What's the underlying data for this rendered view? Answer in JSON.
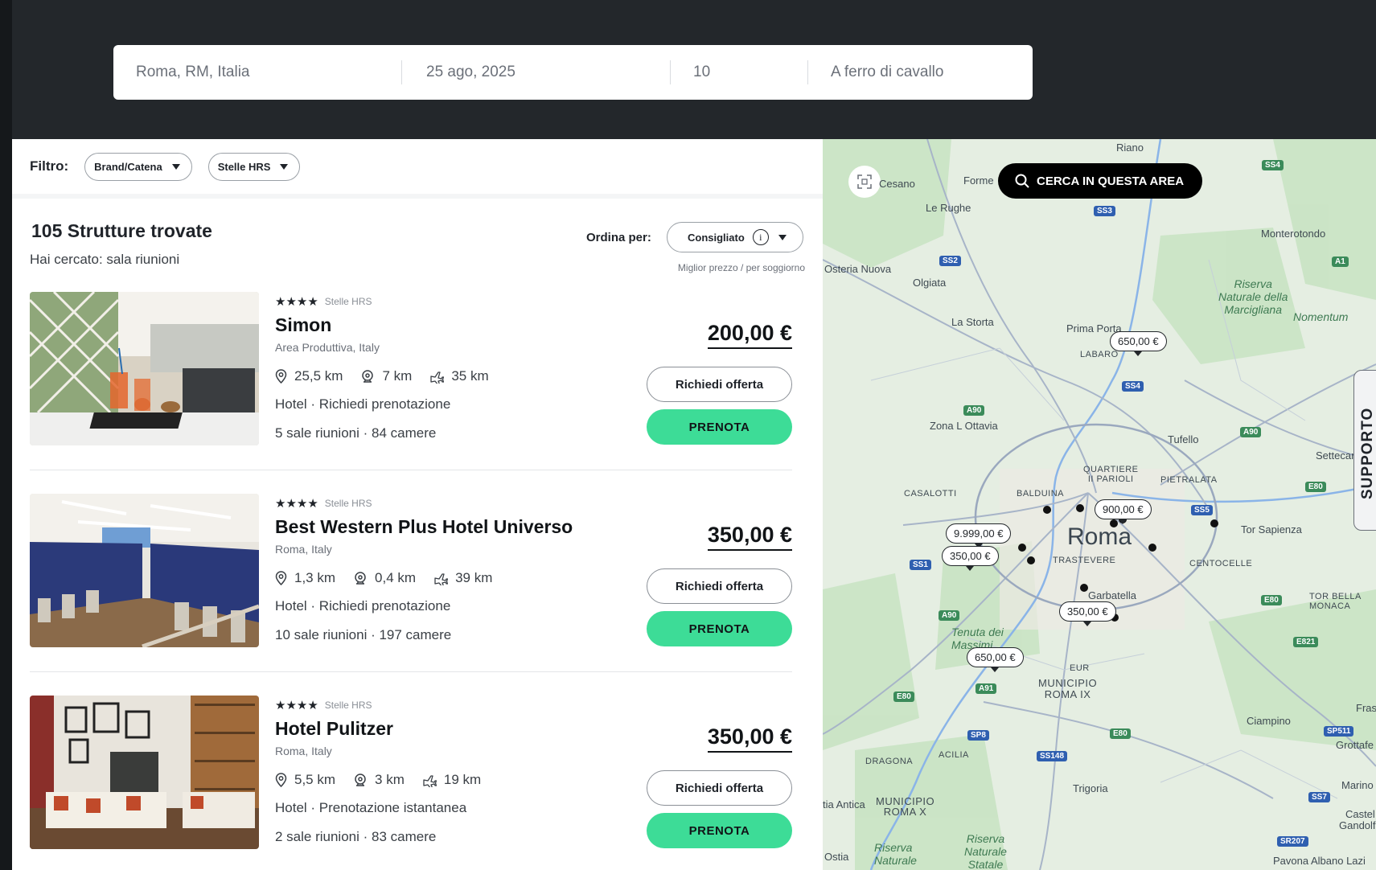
{
  "search": {
    "location": "Roma, RM, Italia",
    "date": "25 ago, 2025",
    "guests": "10",
    "layout": "A ferro di cavallo"
  },
  "filters": {
    "label": "Filtro:",
    "chips": [
      "Brand/Catena",
      "Stelle HRS"
    ]
  },
  "results": {
    "title": "105 Strutture trovate",
    "subtitle": "Hai cercato: sala riunioni",
    "sort_label": "Ordina per:",
    "sort_value": "Consigliato",
    "info_glyph": "i",
    "price_note": "Miglior prezzo / per soggiorno"
  },
  "hotels": [
    {
      "stars": "★★★★",
      "stars_label": "Stelle HRS",
      "name": "Simon",
      "location": "Area Produttiva, Italy",
      "dist_center": "25,5 km",
      "dist_station": "7 km",
      "dist_airport": "35 km",
      "type": "Hotel · Richiedi prenotazione",
      "rooms": "5 sale riunioni · 84 camere",
      "price": "200,00 €",
      "offer_label": "Richiedi offerta",
      "book_label": "PRENOTA"
    },
    {
      "stars": "★★★★",
      "stars_label": "Stelle HRS",
      "name": "Best Western Plus Hotel Universo",
      "location": "Roma, Italy",
      "dist_center": "1,3 km",
      "dist_station": "0,4 km",
      "dist_airport": "39 km",
      "type": "Hotel · Richiedi prenotazione",
      "rooms": "10 sale riunioni · 197 camere",
      "price": "350,00 €",
      "offer_label": "Richiedi offerta",
      "book_label": "PRENOTA"
    },
    {
      "stars": "★★★★",
      "stars_label": "Stelle HRS",
      "name": "Hotel Pulitzer",
      "location": "Roma, Italy",
      "dist_center": "5,5 km",
      "dist_station": "3 km",
      "dist_airport": "19 km",
      "type": "Hotel · Prenotazione istantanea",
      "rooms": "2 sale riunioni · 83 camere",
      "price": "350,00 €",
      "offer_label": "Richiedi offerta",
      "book_label": "PRENOTA"
    }
  ],
  "map": {
    "search_area_label": "CERCA IN QUESTA AREA",
    "support_label": "SUPPORTO",
    "price_pins": [
      "650,00 €",
      "900,00 €",
      "9.999,00 €",
      "350,00 €",
      "350,00 €",
      "650,00 €"
    ],
    "places": {
      "cesano": "Cesano",
      "formello": "Forme",
      "le_rughe": "Le Rughe",
      "riano": "Riano",
      "monterotondo": "Monterotondo",
      "osteria_nuova": "Osteria Nuova",
      "olgiata": "Olgiata",
      "la_storta": "La Storta",
      "prima_porta": "Prima Porta",
      "labaro": "LABARO",
      "riserva_marcigliana": "Riserva\nNaturale della\nMarcigliana",
      "nomentum": "Nomentum",
      "zona_ottavia": "Zona L Ottavia",
      "tufello": "Tufello",
      "settecamini": "Settecami",
      "casalotti": "CASALOTTI",
      "balduina": "BALDUINA",
      "quartiere_parioli": "QUARTIERE\nII PARIOLI",
      "pietralata": "PIETRALATA",
      "sapienza": "Tor Sapienza",
      "roma": "Roma",
      "trastevere": "TRASTEVERE",
      "centocelle": "CENTOCELLE",
      "garbatella": "Garbatella",
      "tenuta_massimi": "Tenuta dei\nMassimi",
      "tor_bella_monaca": "TOR BELLA\nMONACA",
      "eur": "EUR",
      "municipio_ix": "MUNICIPIO\nROMA IX",
      "ciampino": "Ciampino",
      "grottaferrata": "Grottafe",
      "dragona": "DRAGONA",
      "acilia": "ACILIA",
      "trigoria": "Trigoria",
      "marino": "Marino",
      "castel_gandolfo": "Castel\nGandolfo",
      "ostia_antica": "tia Antica",
      "municipio_x": "MUNICIPIO\nROMA X",
      "riserva_statale": "Riserva\nNaturale\nStatale",
      "riserva_naturale2": "Riserva\nNaturale",
      "ostia": "Ostia",
      "pavona": "Pavona Albano Lazi",
      "fras": "Fras"
    },
    "shields": [
      "SS4",
      "SS3",
      "SS2",
      "A1",
      "SS4",
      "A90",
      "A90",
      "SS5",
      "E80",
      "SS1",
      "A90",
      "E80",
      "E821",
      "A91",
      "E80",
      "SP8",
      "E80",
      "SS148",
      "SS7",
      "SP511",
      "SR207"
    ]
  },
  "colors": {
    "topbar": "#23272b",
    "book_button": "#3ddc97",
    "map_green": "#3b8b5a",
    "map_blue": "#2f5fb0"
  },
  "icons": {
    "center": "location-pin-icon",
    "station": "train-icon",
    "airport": "airplane-icon",
    "search": "search-icon",
    "expand": "expand-icon"
  }
}
